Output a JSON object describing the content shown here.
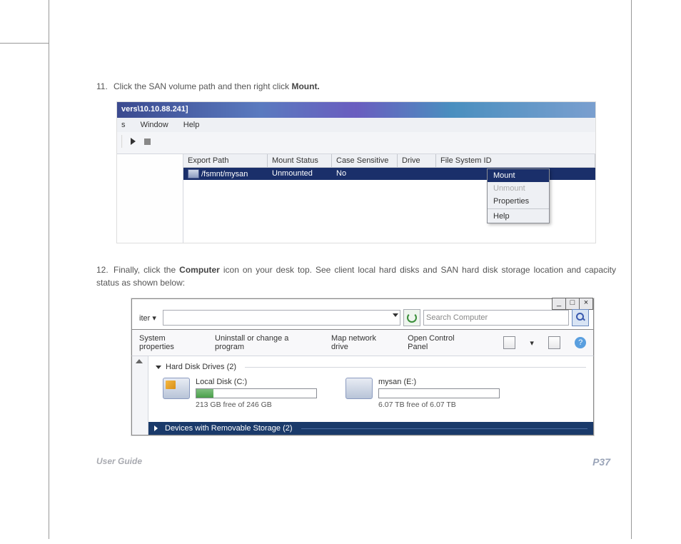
{
  "steps": {
    "s11_num": "11.",
    "s11_a": "Click the SAN volume path and then right click ",
    "s11_b": "Mount.",
    "s12_num": "12.",
    "s12_a": "Finally, click the ",
    "s12_b": "Computer",
    "s12_c": " icon on your desk top. See client local hard disks and SAN hard disk storage location and capacity status as shown below:"
  },
  "ss1": {
    "title": "vers\\10.10.88.241]",
    "menu": {
      "m1": "s",
      "m2": "Window",
      "m3": "Help"
    },
    "cols": {
      "export": "Export Path",
      "mount": "Mount Status",
      "case": "Case Sensitive",
      "drive": "Drive",
      "fsid": "File System ID"
    },
    "row": {
      "export": "/fsmnt/mysan",
      "mount": "Unmounted",
      "case": "No"
    },
    "ctx": {
      "mount": "Mount",
      "unmount": "Unmount",
      "props": "Properties",
      "help": "Help"
    }
  },
  "ss2": {
    "win": {
      "min": "_",
      "max": "□",
      "close": "×"
    },
    "dropdown": "iter",
    "search_placeholder": "Search Computer",
    "cmds": {
      "sys": "System properties",
      "uninst": "Uninstall or change a program",
      "map": "Map network drive",
      "ctrl": "Open Control Panel"
    },
    "help": "?",
    "grp1": "Hard Disk Drives (2)",
    "grp2": "Devices with Removable Storage (2)",
    "drives": {
      "local": {
        "name": "Local Disk (C:)",
        "free": "213 GB free of 246 GB",
        "fill_pct": 14
      },
      "san": {
        "name": "mysan (E:)",
        "free": "6.07 TB free of 6.07 TB",
        "fill_pct": 0
      }
    }
  },
  "footer": {
    "guide": "User Guide",
    "page": "P37"
  }
}
